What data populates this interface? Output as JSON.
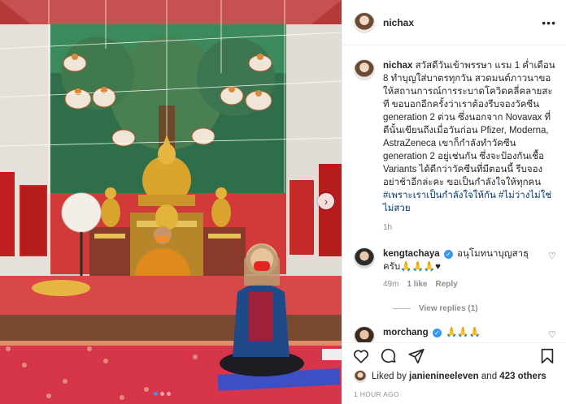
{
  "post": {
    "username": "nichax",
    "caption": "สวัสดีวันเข้าพรรษา แรม 1 ค่ำเดือน 8 ทำบุญใส่บาตรทุกวัน สวดมนต์ภาวนาขอให้สถานการณ์การระบาดโควิดคลี่คลายสะที ขอบอกอีกครั้งว่าเราต้องรีบจองวัคซีน generation 2 ด่วน ซึ่งนอกจาก Novavax ที่ดีนั้นเขียนถึงเมื่อวันก่อน Pfizer, Moderna, AstraZeneca เขาก็กำลังทำวัคซีน generation 2 อยู่เช่นกัน ซึ่งจะป้องกันเชื้อ Variants ได้ดีกว่าวัคซีนที่มีตอนนี้ รีบจองอย่าช้าอีกล่ะคะ ขอเป็นกำลังใจให้ทุกคน",
    "hashtags": "#เพราะเราเป็นกำลังใจให้กัน #ไม่ว่างไม่ใช่ไม่สวย",
    "caption_time": "1h",
    "liked_by_prefix": "Liked by",
    "liked_by_user": "janienineeleven",
    "liked_by_and": "and",
    "liked_by_count": "423 others",
    "time_ago": "1 HOUR AGO"
  },
  "comments": [
    {
      "username": "kengtachaya",
      "verified": true,
      "text": "อนุโมทนาบุญสาธุครับ🙏🙏🙏♥",
      "time": "49m",
      "likes": "1 like",
      "reply": "Reply",
      "view_replies": "View replies (1)"
    },
    {
      "username": "morchang",
      "verified": true,
      "text": "🙏🙏🙏"
    }
  ],
  "icons": {
    "more": "more-options-icon",
    "like": "heart-icon",
    "comment": "comment-icon",
    "share": "paper-plane-icon",
    "save": "bookmark-icon",
    "next": "chevron-right-icon"
  },
  "colors": {
    "link": "#00376b",
    "verified": "#3897f0",
    "muted": "#8e8e8e"
  }
}
